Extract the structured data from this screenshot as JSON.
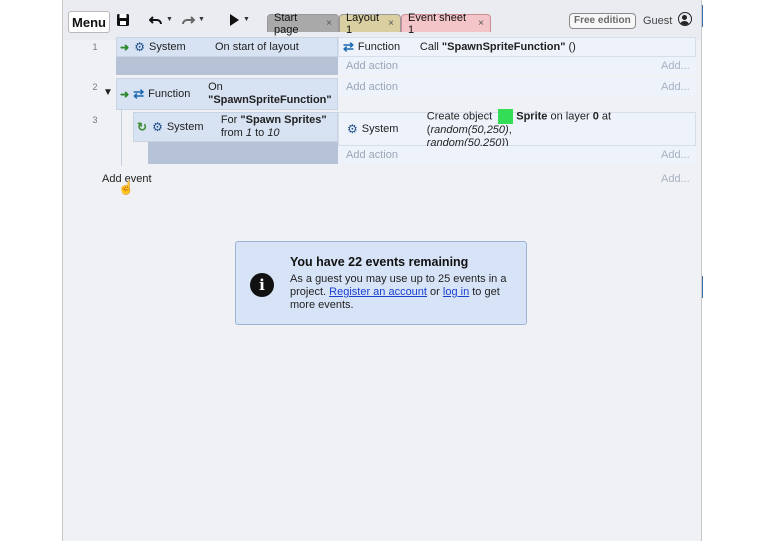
{
  "toolbar": {
    "menu_label": "Menu",
    "tabs": [
      {
        "label": "Start page"
      },
      {
        "label": "Layout 1"
      },
      {
        "label": "Event sheet 1"
      }
    ],
    "tab_close_glyph": "×",
    "free_edition_label": "Free edition",
    "guest_label": "Guest"
  },
  "icons": {
    "save": "save-icon",
    "undo": "undo-icon",
    "redo": "redo-icon",
    "play": "play-icon",
    "user": "user-icon",
    "system": "gear-icon",
    "function": "function-icon",
    "loop": "loop-icon",
    "info": "info-icon"
  },
  "events": [
    {
      "number": "1",
      "condition": {
        "object": "System",
        "text": "On start of layout"
      },
      "actions": [
        {
          "object": "Function",
          "prefix": "Call ",
          "name": "\"SpawnSpriteFunction\"",
          "suffix": " ()"
        }
      ],
      "add_action_label": "Add action",
      "add_label": "Add..."
    },
    {
      "number": "2",
      "condition": {
        "object": "Function",
        "line1": "On",
        "line2": "\"SpawnSpriteFunction\""
      },
      "add_action_label": "Add action",
      "add_label": "Add..."
    },
    {
      "number": "3",
      "condition": {
        "object": "System",
        "line1_prefix": "For ",
        "line1_name": "\"Spawn Sprites\"",
        "line2_prefix": "from ",
        "from": "1",
        "to_word": " to ",
        "to": "10"
      },
      "actions": [
        {
          "object": "System",
          "prefix": "Create object ",
          "sprite_name": "Sprite",
          "layer_text": " on layer ",
          "layer": "0",
          "at_text": " at (",
          "x": "random(50,250)",
          "comma": ",",
          "y": "random(50,250)",
          "close": ")"
        }
      ],
      "add_action_label": "Add action",
      "add_label": "Add..."
    }
  ],
  "add_event_label": "Add event",
  "add_event_right_label": "Add...",
  "info_panel": {
    "title": "You have 22 events remaining",
    "text1": "As a guest you may use up to 25 events in a project. ",
    "link1": "Register an account",
    "text2": " or ",
    "link2": "log in",
    "text3": " to get more events."
  },
  "colors": {
    "sprite_swatch": "#33dd55",
    "tab_event_sheet": "#f4c5c8",
    "tab_layout": "#d9cfa0",
    "tab_start": "#a9a9a9",
    "link": "#1a3fd0"
  }
}
